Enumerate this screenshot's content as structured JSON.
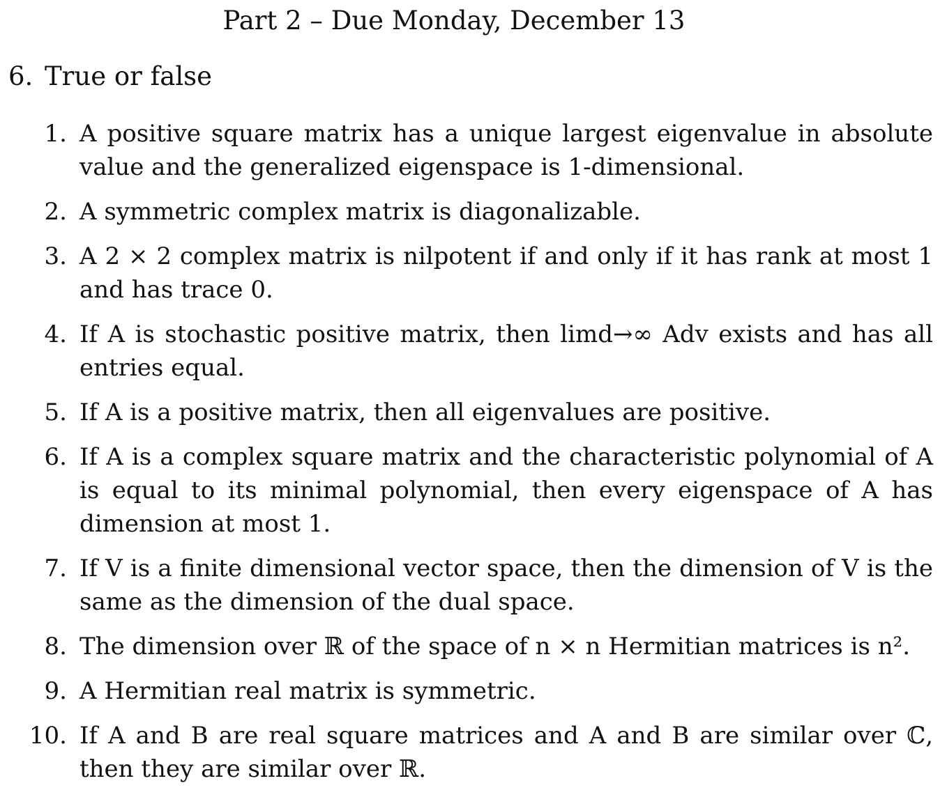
{
  "header": {
    "title": "Part 2 – Due Monday, December 13"
  },
  "question": {
    "number": "6.",
    "title": "True or false"
  },
  "statements": [
    {
      "number": "1.",
      "text": "A positive square matrix has a unique largest eigenvalue in absolute value and the generalized eigenspace is 1-dimensional."
    },
    {
      "number": "2.",
      "text": "A symmetric complex matrix is diagonalizable."
    },
    {
      "number": "3.",
      "text": "A 2 × 2 complex matrix is nilpotent if and only if it has rank at most 1 and has trace 0."
    },
    {
      "number": "4.",
      "text": "If A is stochastic positive matrix, then limd→∞ Adv exists and has all entries equal."
    },
    {
      "number": "5.",
      "text": "If A is a positive matrix, then all eigenvalues are positive."
    },
    {
      "number": "6.",
      "text": "If A is a complex square matrix and the characteristic polynomial of A is equal to its minimal polynomial, then every eigenspace of A has dimension at most 1."
    },
    {
      "number": "7.",
      "text": "If V is a finite dimensional vector space, then the dimension of V is the same as the dimension of the dual space."
    },
    {
      "number": "8.",
      "text": "The dimension over ℝ of the space of n × n Hermitian matrices is n²."
    },
    {
      "number": "9.",
      "text": "A Hermitian real matrix is symmetric."
    },
    {
      "number": "10.",
      "text": "If A and B are real square matrices and A and B are similar over ℂ, then they are similar over ℝ."
    }
  ]
}
